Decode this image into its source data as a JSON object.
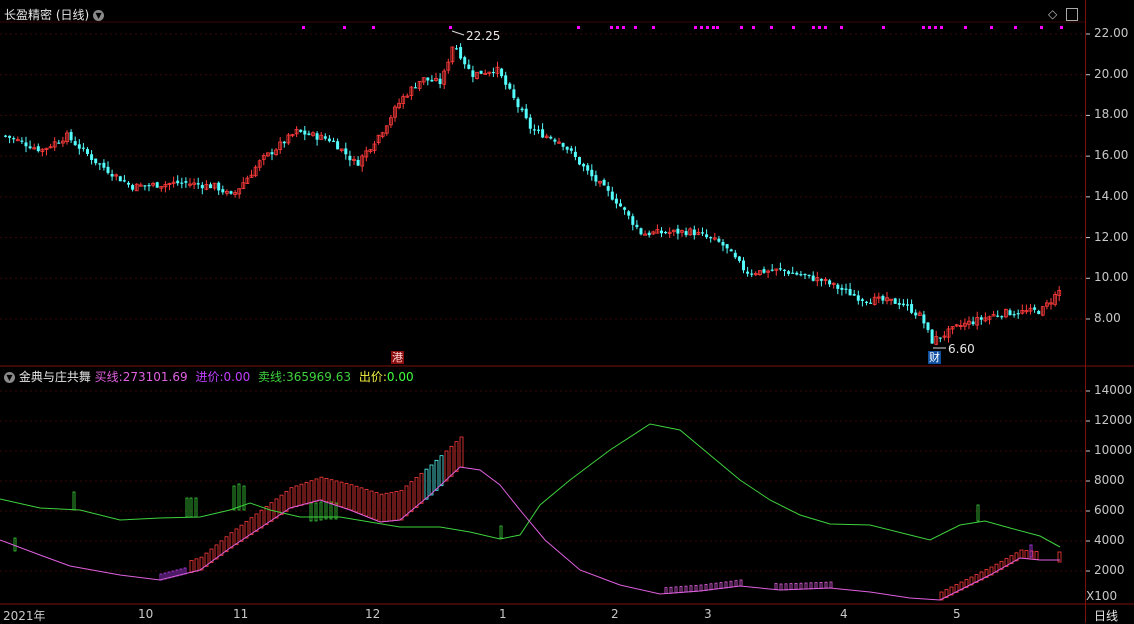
{
  "top_panel": {
    "title": "长盈精密 (日线)",
    "high_label": "22.25",
    "low_label": "6.60",
    "event_hk": "港",
    "event_cai": "财",
    "yticks": [
      "22.00",
      "20.00",
      "18.00",
      "16.00",
      "14.00",
      "12.00",
      "10.00",
      "8.00"
    ]
  },
  "bottom_panel": {
    "indicator_name": "金典与庄共舞",
    "buy_label": "买线:",
    "buy_value": "273101.69",
    "in_label": "进价:",
    "in_value": "0.00",
    "sell_label": "卖线:",
    "sell_value": "365969.63",
    "out_label": "出价:",
    "out_value": "0.00",
    "yticks": [
      "14000",
      "12000",
      "10000",
      "8000",
      "6000",
      "4000",
      "2000"
    ],
    "multiplier": "X100"
  },
  "x_axis": {
    "labels": [
      "2021年",
      "10",
      "11",
      "12",
      "1",
      "2",
      "3",
      "4",
      "5"
    ],
    "period": "日线"
  },
  "colors": {
    "up": "#ff3b3b",
    "down": "#54fcfc",
    "buy_line": "#e060e0",
    "sell_line": "#3ed23e",
    "marker": "#ff00ff",
    "grid": "#5a0a0a"
  },
  "chart_data": {
    "type": "line",
    "title": "长盈精密 (日线)",
    "x": [
      "2021年",
      "10",
      "11",
      "12",
      "1",
      "2",
      "3",
      "4",
      "5"
    ],
    "series": [
      {
        "name": "买线",
        "values": [
          2300,
          1500,
          3200,
          6800,
          8900,
          900,
          1300,
          1100,
          300,
          3000
        ]
      },
      {
        "name": "卖线",
        "values": [
          6600,
          5600,
          6600,
          5000,
          4200,
          11900,
          7000,
          5000,
          4100,
          3500
        ]
      }
    ],
    "price_range": [
      6.6,
      22.25
    ],
    "ylim_price": [
      6.0,
      23.0
    ],
    "ylim_indicator": [
      0,
      15000
    ]
  }
}
